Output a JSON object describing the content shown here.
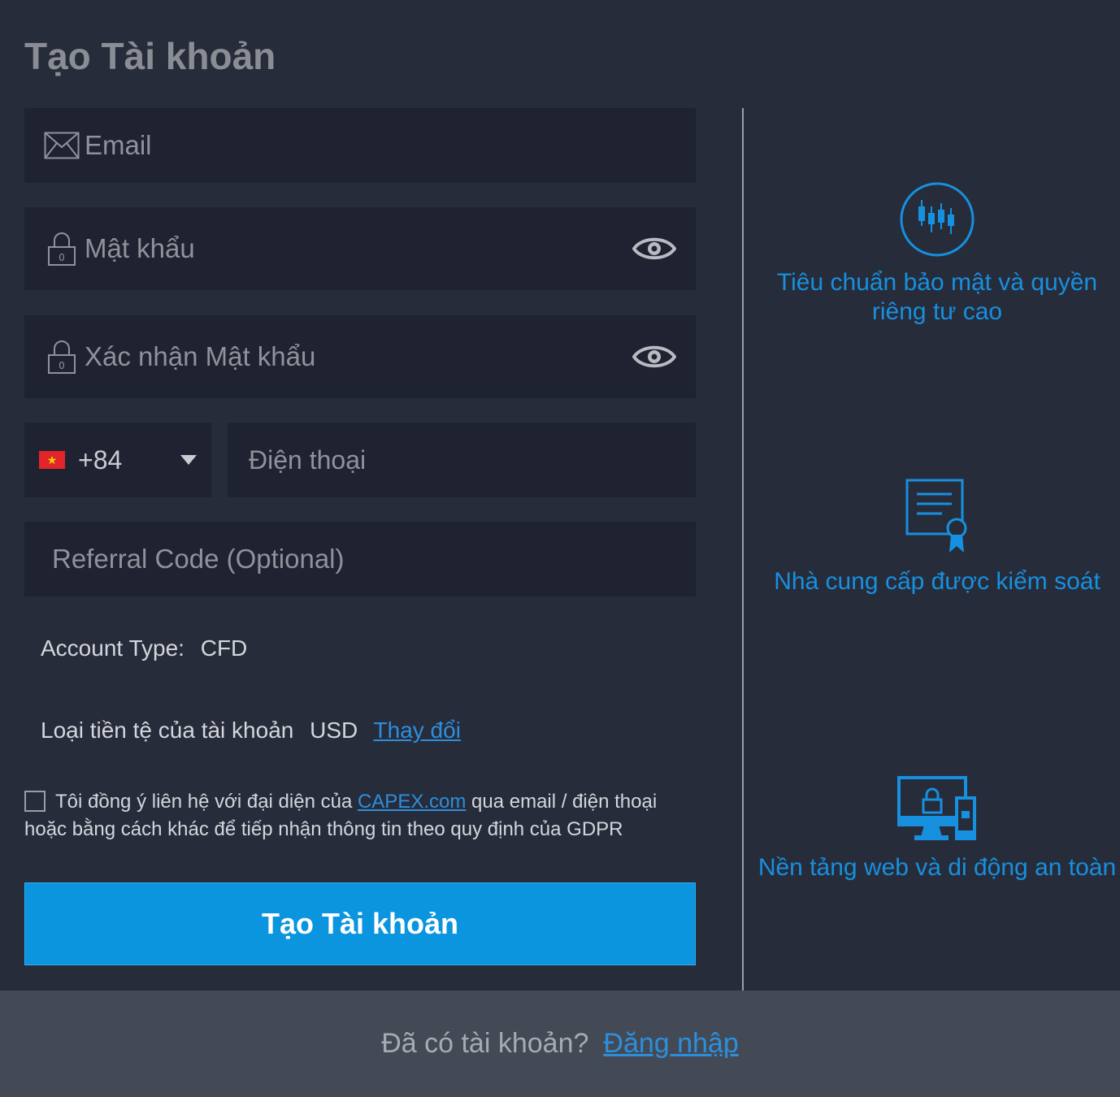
{
  "page": {
    "title": "Tạo Tài khoản"
  },
  "form": {
    "email_placeholder": "Email",
    "password_placeholder": "Mật khẩu",
    "confirm_password_placeholder": "Xác nhận Mật khẩu",
    "phone_code": "+84",
    "phone_placeholder": "Điện thoại",
    "referral_placeholder": "Referral Code (Optional)",
    "account_type_label": "Account Type:",
    "account_type_value": "CFD",
    "currency_label": "Loại tiền tệ của tài khoản",
    "currency_value": "USD",
    "currency_change_link": "Thay đổi",
    "consent_text_before": "Tôi đồng ý liên hệ với đại diện của",
    "consent_link": "CAPEX.com",
    "consent_text_after": "qua email / điện thoại hoặc bằng cách khác để tiếp nhận thông tin theo quy định của GDPR",
    "submit_label": "Tạo Tài khoản"
  },
  "features": [
    {
      "icon": "candlestick-chart-icon",
      "text": "Tiêu chuẩn bảo mật và quyền riêng tư cao"
    },
    {
      "icon": "certificate-icon",
      "text": "Nhà cung cấp được kiểm soát"
    },
    {
      "icon": "secure-devices-icon",
      "text": "Nền tảng web và di động an toàn"
    }
  ],
  "footer": {
    "question": "Đã có tài khoản?",
    "login_link": "Đăng nhập"
  },
  "colors": {
    "background": "#272c3b",
    "field": "#1f2230",
    "accent": "#0b95de",
    "link": "#2c8fdc",
    "footer": "#434a56"
  }
}
